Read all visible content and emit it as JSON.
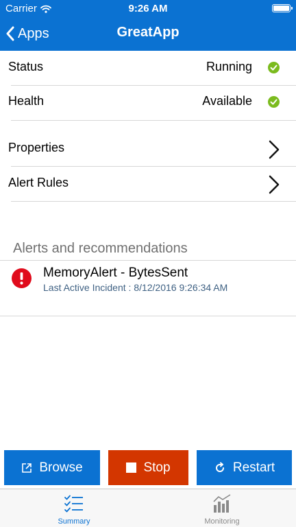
{
  "status_bar": {
    "carrier": "Carrier",
    "time": "9:26 AM"
  },
  "nav": {
    "back_label": "Apps",
    "title": "GreatApp"
  },
  "rows": [
    {
      "label": "Status",
      "value": "Running"
    },
    {
      "label": "Health",
      "value": "Available"
    },
    {
      "label": "Properties"
    },
    {
      "label": "Alert Rules"
    }
  ],
  "alerts": {
    "section_title": "Alerts and recommendations",
    "items": [
      {
        "title": "MemoryAlert - BytesSent",
        "subtitle": "Last Active Incident : 8/12/2016 9:26:34 AM"
      }
    ]
  },
  "actions": {
    "browse": "Browse",
    "stop": "Stop",
    "restart": "Restart"
  },
  "tabs": [
    {
      "label": "Summary",
      "selected": true
    },
    {
      "label": "Monitoring",
      "selected": false
    }
  ],
  "colors": {
    "accent": "#0b72d2",
    "stop": "#d33600",
    "ok": "#7bbb1e",
    "error": "#e00b1c"
  },
  "icons": {
    "wifi": "wifi-icon",
    "battery": "battery-icon",
    "back": "chevron-left-icon",
    "ok": "checkmark-circle-icon",
    "disclosure": "chevron-right-icon",
    "alert": "exclamation-circle-icon",
    "browse": "external-link-icon",
    "stop": "stop-square-icon",
    "restart": "refresh-icon",
    "summary": "checklist-icon",
    "monitoring": "bar-chart-icon"
  }
}
